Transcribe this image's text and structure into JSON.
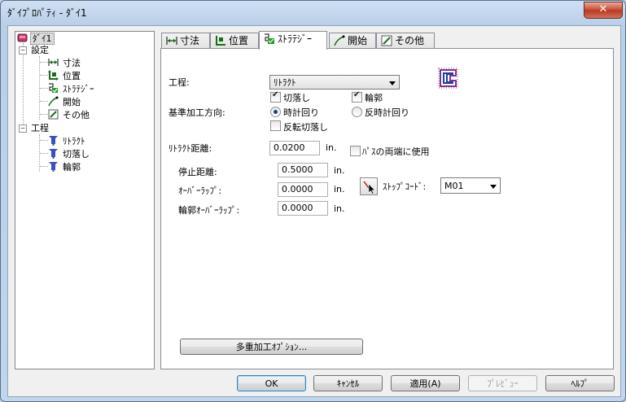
{
  "window": {
    "title": "ﾀﾞｲﾌﾟﾛﾊﾟﾃｨ - ﾀﾞｲ1",
    "close_glyph": "✕"
  },
  "tree": {
    "root": "ﾀﾞｲ1",
    "settings": "設定",
    "settings_items": [
      "寸法",
      "位置",
      "ｽﾄﾗﾃｼﾞｰ",
      "開始",
      "その他"
    ],
    "process": "工程",
    "process_items": [
      "ﾘﾄﾗｸﾄ",
      "切落し",
      "輪郭"
    ]
  },
  "tabs": [
    "寸法",
    "位置",
    "ｽﾄﾗﾃｼﾞｰ",
    "開始",
    "その他"
  ],
  "strategy": {
    "process_label": "工程:",
    "process_value": "ﾘﾄﾗｸﾄ",
    "cutoff_label": "切落し",
    "cutoff_checked": true,
    "contour_label": "輪郭",
    "contour_checked": true,
    "direction_label": "基準加工方向:",
    "clockwise_label": "時計回り",
    "clockwise_selected": true,
    "counterclockwise_label": "反時計回り",
    "reverse_cutoff_label": "反転切落し",
    "reverse_cutoff_checked": false,
    "retract_label": "ﾘﾄﾗｸﾄ距離:",
    "retract_value": "0.0200",
    "retract_unit": "in.",
    "both_ends_label": "ﾊﾟｽの両端に使用",
    "both_ends_checked": false,
    "stop_distance_label": "停止距離:",
    "stop_distance_value": "0.5000",
    "stop_distance_unit": "in.",
    "overlap_label": "ｵｰﾊﾞｰﾗｯﾌﾟ:",
    "overlap_value": "0.0000",
    "overlap_unit": "in.",
    "contour_overlap_label": "輪郭ｵｰﾊﾞｰﾗｯﾌﾟ:",
    "contour_overlap_value": "0.0000",
    "contour_overlap_unit": "in.",
    "stop_code_label": "ｽﾄｯﾌﾟｺｰﾄﾞ:",
    "stop_code_value": "M01",
    "multi_option_button": "多重加工ｵﾌﾟｼｮﾝ..."
  },
  "footer": {
    "ok": "OK",
    "cancel": "ｷｬﾝｾﾙ",
    "apply": "適用(A)",
    "preview": "ﾌﾟﾚﾋﾞｭｰ",
    "help": "ﾍﾙﾌﾟ"
  }
}
